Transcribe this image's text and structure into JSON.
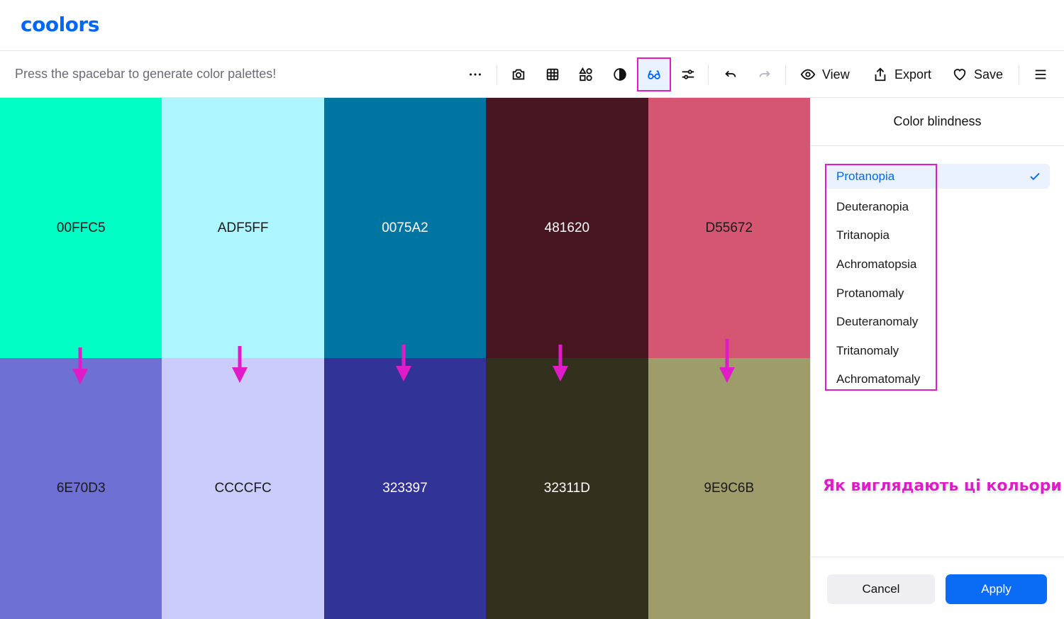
{
  "app": {
    "logo": "coolors",
    "hint": "Press the spacebar to generate color palettes!"
  },
  "toolbar": {
    "icons": [
      "more-icon",
      "camera-icon",
      "grid-icon",
      "shapes-icon",
      "contrast-icon",
      "glasses-icon",
      "sliders-icon",
      "undo-icon",
      "redo-icon"
    ],
    "view_label": "View",
    "export_label": "Export",
    "save_label": "Save",
    "active_tool": "glasses-icon",
    "disabled_tool": "redo-icon"
  },
  "palette": {
    "original": [
      {
        "hex": "00FFC5",
        "color": "#00FFC5",
        "text_color": "#1a1a1a"
      },
      {
        "hex": "ADF5FF",
        "color": "#ADF5FF",
        "text_color": "#1a1a1a"
      },
      {
        "hex": "0075A2",
        "color": "#0075A2",
        "text_color": "#ffffff"
      },
      {
        "hex": "481620",
        "color": "#481620",
        "text_color": "#ffffff"
      },
      {
        "hex": "D55672",
        "color": "#D55672",
        "text_color": "#1a1a1a"
      }
    ],
    "simulated": [
      {
        "hex": "6E70D3",
        "color": "#6E70D3",
        "text_color": "#1a1a1a"
      },
      {
        "hex": "CCCCFC",
        "color": "#CCCCFC",
        "text_color": "#1a1a1a"
      },
      {
        "hex": "323397",
        "color": "#323397",
        "text_color": "#ffffff"
      },
      {
        "hex": "32311D",
        "color": "#32311D",
        "text_color": "#ffffff"
      },
      {
        "hex": "9E9C6B",
        "color": "#9E9C6B",
        "text_color": "#1a1a1a"
      }
    ]
  },
  "panel": {
    "title": "Color blindness",
    "options": [
      "Protanopia",
      "Deuteranopia",
      "Tritanopia",
      "Achromatopsia",
      "Protanomaly",
      "Deuteranomaly",
      "Tritanomaly",
      "Achromatomaly"
    ],
    "selected": "Protanopia",
    "cancel_label": "Cancel",
    "apply_label": "Apply"
  },
  "annotation": "Як виглядають ці кольори",
  "colors": {
    "accent": "#0066ff",
    "highlight": "#e01cc9"
  }
}
